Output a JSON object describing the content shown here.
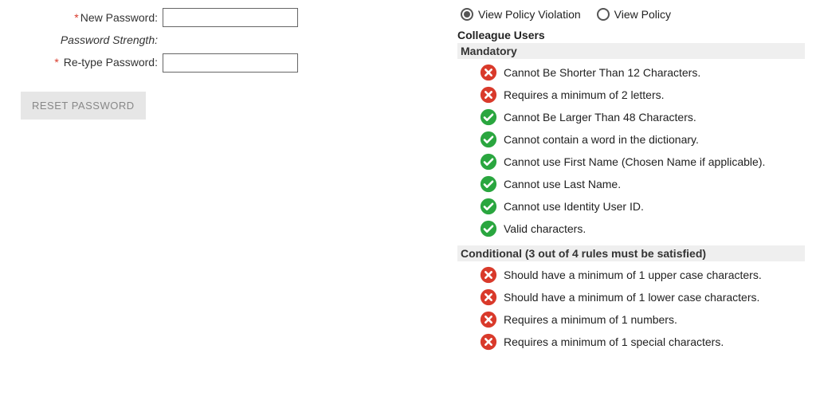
{
  "form": {
    "new_password_label": "New Password:",
    "strength_label": "Password Strength:",
    "retype_label": "Re-type Password:",
    "reset_button": "RESET PASSWORD"
  },
  "view": {
    "option_violation": "View Policy Violation",
    "option_policy": "View Policy",
    "selected": "violation"
  },
  "policy": {
    "section_title": "Colleague Users",
    "mandatory_title": "Mandatory",
    "conditional_title": "Conditional (3 out of 4 rules must be satisfied)",
    "mandatory_rules": [
      {
        "status": "fail",
        "text": "Cannot Be Shorter Than 12 Characters."
      },
      {
        "status": "fail",
        "text": "Requires a minimum of 2 letters."
      },
      {
        "status": "pass",
        "text": "Cannot Be Larger Than 48 Characters."
      },
      {
        "status": "pass",
        "text": "Cannot contain a word in the dictionary."
      },
      {
        "status": "pass",
        "text": "Cannot use First Name (Chosen Name if applicable)."
      },
      {
        "status": "pass",
        "text": "Cannot use Last Name."
      },
      {
        "status": "pass",
        "text": "Cannot use Identity User ID."
      },
      {
        "status": "pass",
        "text": "Valid characters."
      }
    ],
    "conditional_rules": [
      {
        "status": "fail",
        "text": "Should have a minimum of 1 upper case characters."
      },
      {
        "status": "fail",
        "text": "Should have a minimum of 1 lower case characters."
      },
      {
        "status": "fail",
        "text": "Requires a minimum of 1 numbers."
      },
      {
        "status": "fail",
        "text": "Requires a minimum of 1 special characters."
      }
    ]
  },
  "colors": {
    "fail": "#d93a2b",
    "pass": "#2aa63f"
  }
}
